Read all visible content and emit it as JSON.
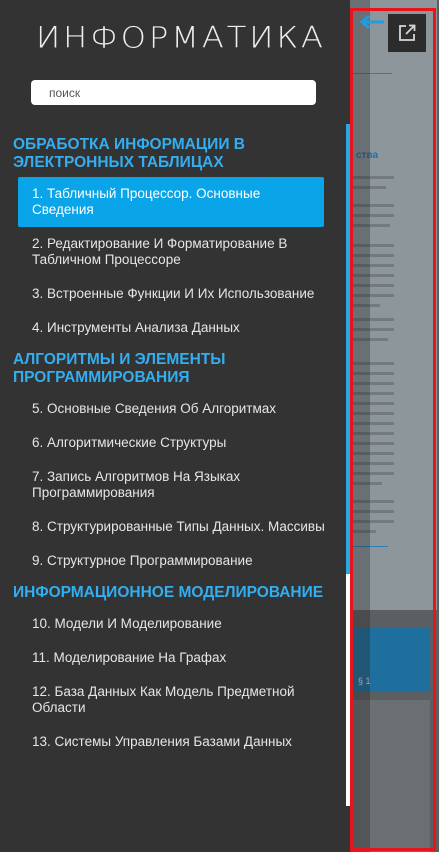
{
  "app": {
    "logo": "ИНФОРМАТИКА"
  },
  "search": {
    "placeholder": "поиск"
  },
  "toc": {
    "sections": [
      {
        "title": "ОБРАБОТКА ИНФОРМАЦИИ В ЭЛЕКТРОННЫХ ТАБЛИЦАХ",
        "items": [
          "1. Табличный Процессор. Основные Сведения",
          "2. Редактирование И Форматирование В Табличном Процессоре",
          "3. Встроенные Функции И Их Использование",
          "4. Инструменты Анализа Данных"
        ]
      },
      {
        "title": "АЛГОРИТМЫ И ЭЛЕМЕНТЫ ПРОГРАММИРОВАНИЯ",
        "items": [
          "5. Основные Сведения Об Алгоритмах",
          "6. Алгоритмические Структуры",
          "7. Запись Алгоритмов На Языках Программирования",
          "8. Структурированные Типы Данных. Массивы",
          "9. Структурное Программирование"
        ]
      },
      {
        "title": "ИНФОРМАЦИОННОЕ МОДЕЛИРОВАНИЕ",
        "items": [
          "10. Модели И Моделирование",
          "11. Моделирование На Графах",
          "12. База Данных Как Модель Предметной Области",
          "13. Системы Управления Базами Данных"
        ]
      }
    ],
    "active_item": "1. Табличный Процессор. Основные Сведения"
  },
  "preview": {
    "heading_fragment": "ства",
    "band_label": "§ 1",
    "back_icon": "arrow-left-icon",
    "open_icon": "external-link-icon"
  },
  "colors": {
    "accent": "#33aef0",
    "active_bg": "#0aa5e8",
    "sidebar_bg": "#333333",
    "highlight_border": "#e8141c"
  }
}
